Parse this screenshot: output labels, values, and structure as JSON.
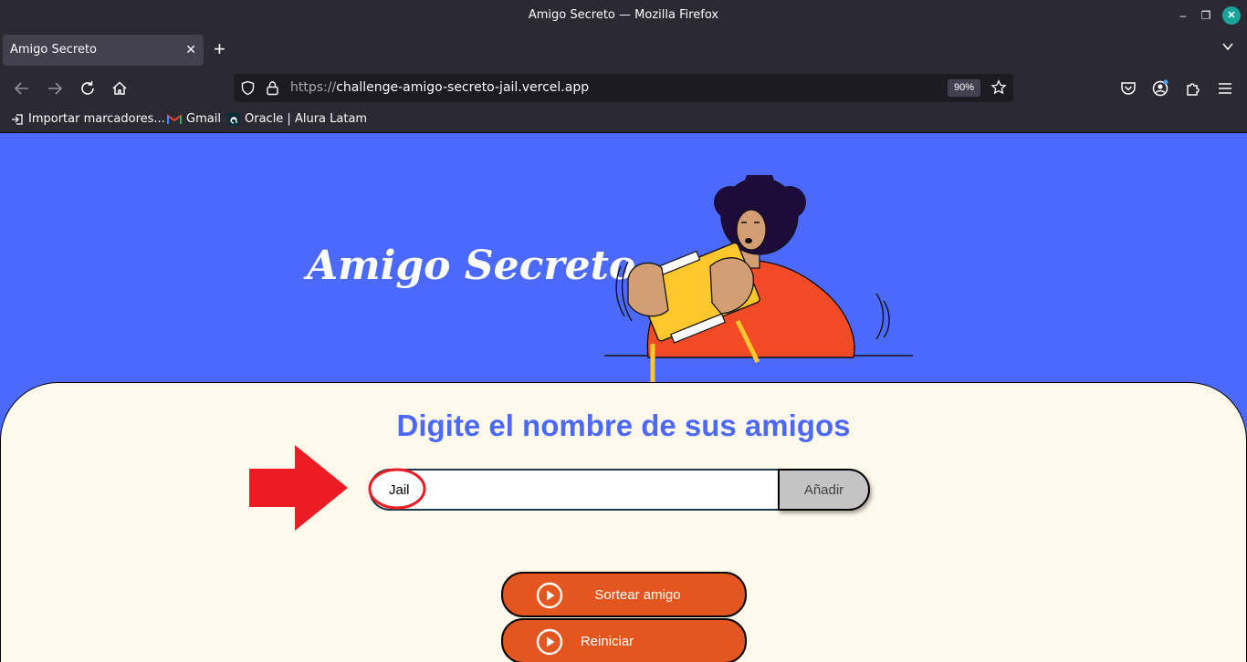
{
  "window": {
    "title": "Amigo Secreto — Mozilla Firefox"
  },
  "tabs": [
    {
      "label": "Amigo Secreto"
    }
  ],
  "urlbar": {
    "scheme": "https://",
    "host": "challenge-amigo-secreto-jail.vercel.app",
    "zoom": "90%"
  },
  "bookmarks": [
    {
      "label": "Importar marcadores..."
    },
    {
      "label": "Gmail"
    },
    {
      "label": "Oracle | Alura Latam"
    }
  ],
  "hero": {
    "title": "Amigo Secreto"
  },
  "form": {
    "heading": "Digite el nombre de sus amigos",
    "input_value": "Jail",
    "add_label": "Añadir"
  },
  "actions": {
    "draw_label": "Sortear amigo",
    "reset_label": "Reiniciar"
  },
  "colors": {
    "hero_bg": "#4b69fd",
    "panel_bg": "#fff9eb",
    "button_orange": "#e3561f",
    "annotation_red": "#ed1c24"
  }
}
